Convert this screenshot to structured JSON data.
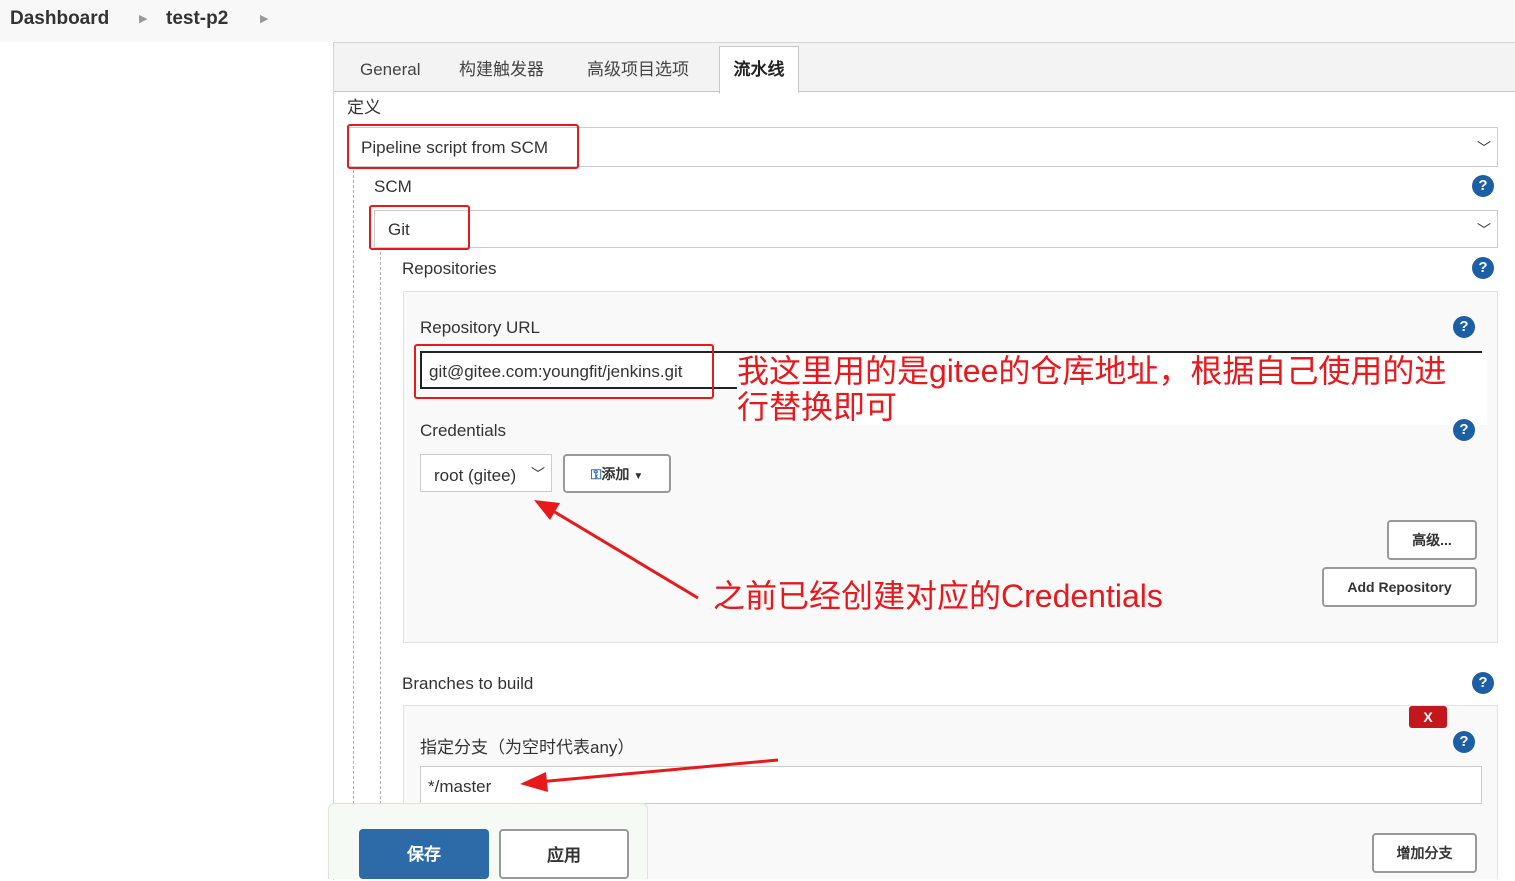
{
  "breadcrumb": {
    "dashboard": "Dashboard",
    "project": "test-p2"
  },
  "tabs": [
    {
      "label": "General"
    },
    {
      "label": "构建触发器"
    },
    {
      "label": "高级项目选项"
    },
    {
      "label": "流水线"
    }
  ],
  "definition": {
    "label": "定义",
    "value": "Pipeline script from SCM"
  },
  "scm": {
    "label": "SCM",
    "value": "Git"
  },
  "repositories": {
    "label": "Repositories",
    "url_label": "Repository URL",
    "url_value": "git@gitee.com:youngfit/jenkins.git",
    "credentials_label": "Credentials",
    "credentials_value": "root (gitee)",
    "add_label": "添加",
    "advanced_label": "高级...",
    "add_repo_label": "Add Repository"
  },
  "branches": {
    "label": "Branches to build",
    "spec_label": "指定分支（为空时代表any）",
    "spec_value": "*/master",
    "delete_label": "X",
    "add_branch_label": "增加分支"
  },
  "footer": {
    "save_label": "保存",
    "apply_label": "应用"
  },
  "annotations": {
    "url_note_line1": "我这里用的是gitee的仓库地址，根据自己使用的进",
    "url_note_line2": "行替换即可",
    "cred_note": "之前已经创建对应的Credentials"
  },
  "colors": {
    "accent": "#2d6aa8",
    "annotation": "#e8191d",
    "help": "#1d5fa5",
    "delete": "#c4171c"
  },
  "icons": {
    "help": "help-icon",
    "chevron": "chevron-down-icon",
    "key": "key-icon"
  }
}
